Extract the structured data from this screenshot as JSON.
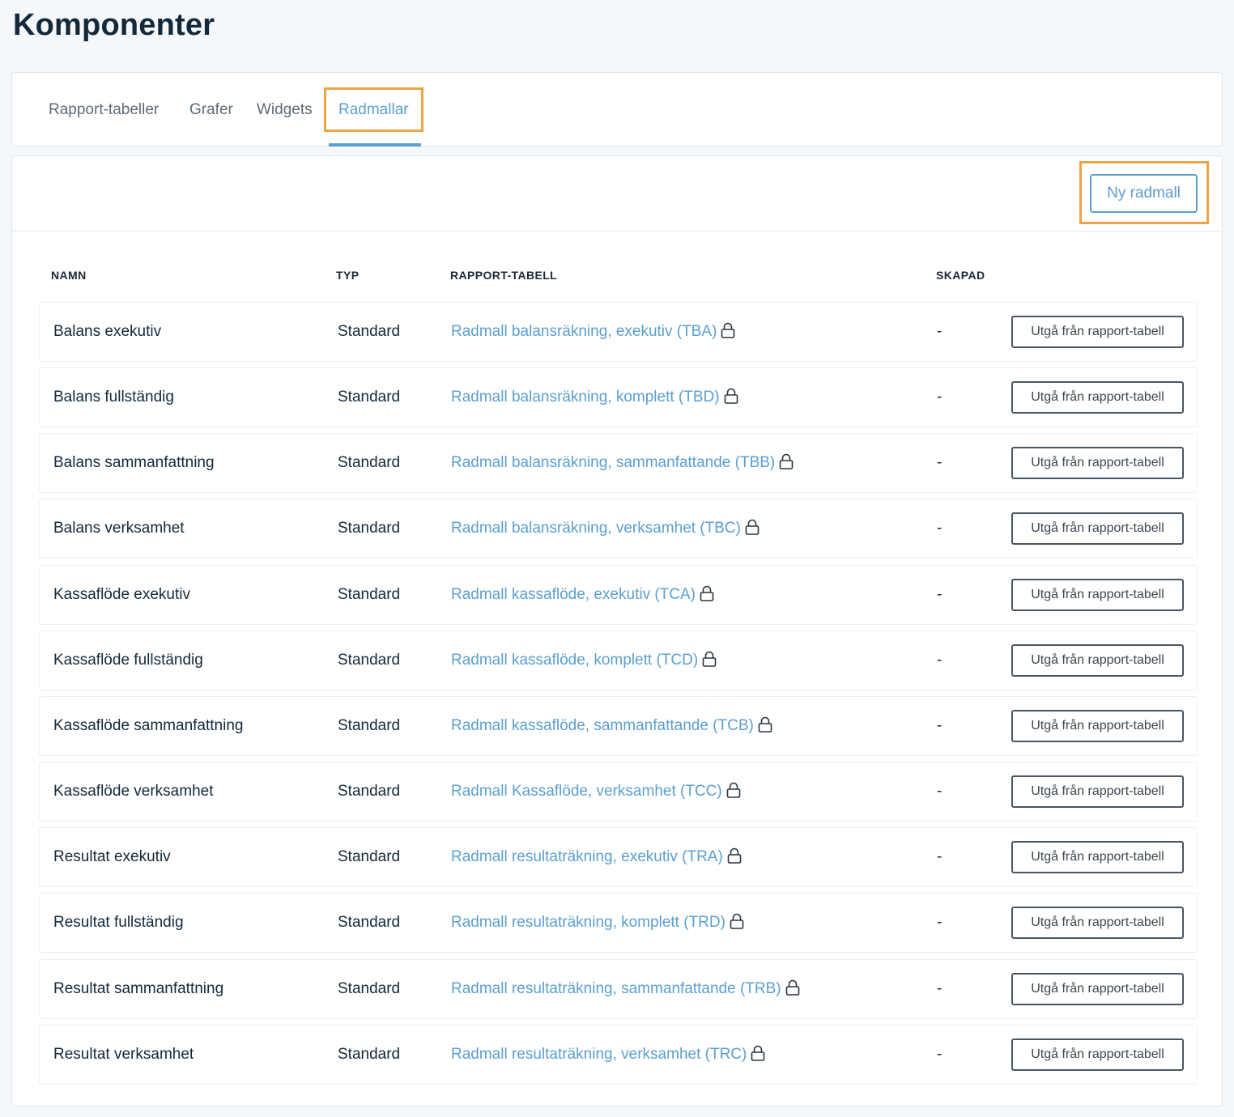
{
  "page": {
    "title": "Komponenter"
  },
  "tabs": [
    {
      "label": "Rapport-tabeller"
    },
    {
      "label": "Grafer"
    },
    {
      "label": "Widgets"
    },
    {
      "label": "Radmallar"
    }
  ],
  "active_tab": "Radmallar",
  "toolbar": {
    "new_button": "Ny radmall"
  },
  "table": {
    "headers": {
      "name": "NAMN",
      "type": "TYP",
      "report": "RAPPORT-TABELL",
      "created": "SKAPAD"
    },
    "action_label": "Utgå från rapport-tabell",
    "lock_icon": "lock-icon",
    "rows": [
      {
        "name": "Balans exekutiv",
        "type": "Standard",
        "report": "Radmall balansräkning, exekutiv (TBA)",
        "created": "-"
      },
      {
        "name": "Balans fullständig",
        "type": "Standard",
        "report": "Radmall balansräkning, komplett (TBD)",
        "created": "-"
      },
      {
        "name": "Balans sammanfattning",
        "type": "Standard",
        "report": "Radmall balansräkning, sammanfattande (TBB)",
        "created": "-"
      },
      {
        "name": "Balans verksamhet",
        "type": "Standard",
        "report": "Radmall balansräkning, verksamhet (TBC)",
        "created": "-"
      },
      {
        "name": "Kassaflöde exekutiv",
        "type": "Standard",
        "report": "Radmall kassaflöde, exekutiv (TCA)",
        "created": "-"
      },
      {
        "name": "Kassaflöde fullständig",
        "type": "Standard",
        "report": "Radmall kassaflöde, komplett (TCD)",
        "created": "-"
      },
      {
        "name": "Kassaflöde sammanfattning",
        "type": "Standard",
        "report": "Radmall kassaflöde, sammanfattande (TCB)",
        "created": "-"
      },
      {
        "name": "Kassaflöde verksamhet",
        "type": "Standard",
        "report": "Radmall Kassaflöde, verksamhet (TCC)",
        "created": "-"
      },
      {
        "name": "Resultat exekutiv",
        "type": "Standard",
        "report": "Radmall resultaträkning, exekutiv (TRA)",
        "created": "-"
      },
      {
        "name": "Resultat fullständig",
        "type": "Standard",
        "report": "Radmall resultaträkning, komplett (TRD)",
        "created": "-"
      },
      {
        "name": "Resultat sammanfattning",
        "type": "Standard",
        "report": "Radmall resultaträkning, sammanfattande (TRB)",
        "created": "-"
      },
      {
        "name": "Resultat verksamhet",
        "type": "Standard",
        "report": "Radmall resultaträkning, verksamhet (TRC)",
        "created": "-"
      }
    ]
  },
  "colors": {
    "accent": "#5b9fd0",
    "highlight": "#f0a346",
    "background": "#f5f8fb",
    "text": "#13293a"
  }
}
